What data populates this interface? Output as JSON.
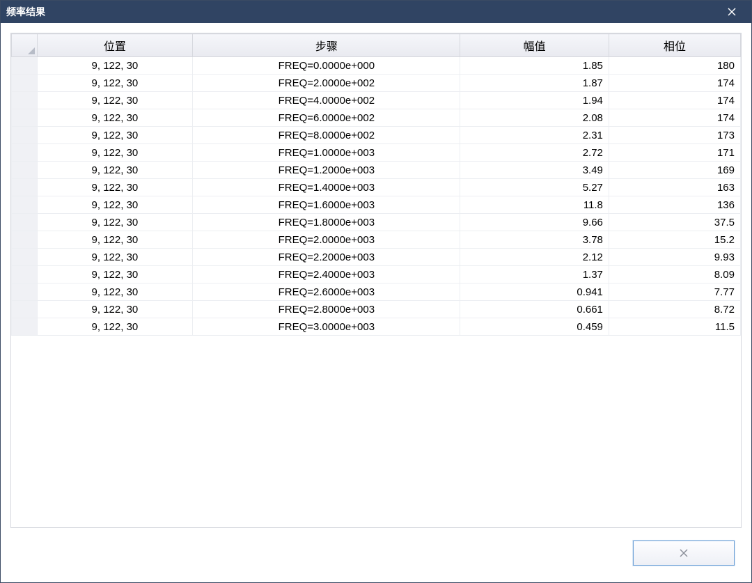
{
  "window": {
    "title": "频率结果"
  },
  "table": {
    "headers": {
      "position": "位置",
      "step": "步骤",
      "amplitude": "幅值",
      "phase": "相位"
    },
    "rows": [
      {
        "position": "9, 122, 30",
        "step": "FREQ=0.0000e+000",
        "amplitude": "1.85",
        "phase": "180"
      },
      {
        "position": "9, 122, 30",
        "step": "FREQ=2.0000e+002",
        "amplitude": "1.87",
        "phase": "174"
      },
      {
        "position": "9, 122, 30",
        "step": "FREQ=4.0000e+002",
        "amplitude": "1.94",
        "phase": "174"
      },
      {
        "position": "9, 122, 30",
        "step": "FREQ=6.0000e+002",
        "amplitude": "2.08",
        "phase": "174"
      },
      {
        "position": "9, 122, 30",
        "step": "FREQ=8.0000e+002",
        "amplitude": "2.31",
        "phase": "173"
      },
      {
        "position": "9, 122, 30",
        "step": "FREQ=1.0000e+003",
        "amplitude": "2.72",
        "phase": "171"
      },
      {
        "position": "9, 122, 30",
        "step": "FREQ=1.2000e+003",
        "amplitude": "3.49",
        "phase": "169"
      },
      {
        "position": "9, 122, 30",
        "step": "FREQ=1.4000e+003",
        "amplitude": "5.27",
        "phase": "163"
      },
      {
        "position": "9, 122, 30",
        "step": "FREQ=1.6000e+003",
        "amplitude": "11.8",
        "phase": "136"
      },
      {
        "position": "9, 122, 30",
        "step": "FREQ=1.8000e+003",
        "amplitude": "9.66",
        "phase": "37.5"
      },
      {
        "position": "9, 122, 30",
        "step": "FREQ=2.0000e+003",
        "amplitude": "3.78",
        "phase": "15.2"
      },
      {
        "position": "9, 122, 30",
        "step": "FREQ=2.2000e+003",
        "amplitude": "2.12",
        "phase": "9.93"
      },
      {
        "position": "9, 122, 30",
        "step": "FREQ=2.4000e+003",
        "amplitude": "1.37",
        "phase": "8.09"
      },
      {
        "position": "9, 122, 30",
        "step": "FREQ=2.6000e+003",
        "amplitude": "0.941",
        "phase": "7.77"
      },
      {
        "position": "9, 122, 30",
        "step": "FREQ=2.8000e+003",
        "amplitude": "0.661",
        "phase": "8.72"
      },
      {
        "position": "9, 122, 30",
        "step": "FREQ=3.0000e+003",
        "amplitude": "0.459",
        "phase": "11.5"
      }
    ]
  }
}
